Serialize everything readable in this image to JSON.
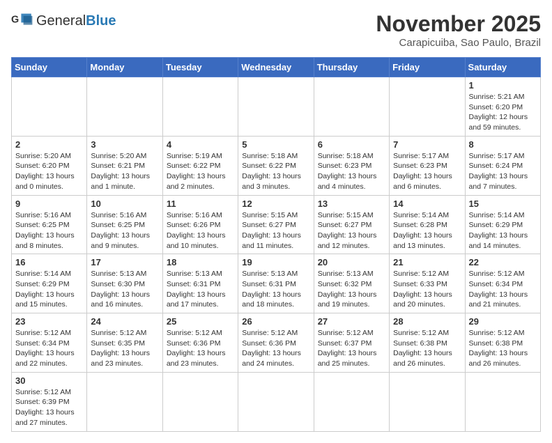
{
  "header": {
    "logo_general": "General",
    "logo_blue": "Blue",
    "month_title": "November 2025",
    "location": "Carapicuiba, Sao Paulo, Brazil"
  },
  "weekdays": [
    "Sunday",
    "Monday",
    "Tuesday",
    "Wednesday",
    "Thursday",
    "Friday",
    "Saturday"
  ],
  "weeks": [
    [
      {
        "day": "",
        "info": ""
      },
      {
        "day": "",
        "info": ""
      },
      {
        "day": "",
        "info": ""
      },
      {
        "day": "",
        "info": ""
      },
      {
        "day": "",
        "info": ""
      },
      {
        "day": "",
        "info": ""
      },
      {
        "day": "1",
        "info": "Sunrise: 5:21 AM\nSunset: 6:20 PM\nDaylight: 12 hours and 59 minutes."
      }
    ],
    [
      {
        "day": "2",
        "info": "Sunrise: 5:20 AM\nSunset: 6:20 PM\nDaylight: 13 hours and 0 minutes."
      },
      {
        "day": "3",
        "info": "Sunrise: 5:20 AM\nSunset: 6:21 PM\nDaylight: 13 hours and 1 minute."
      },
      {
        "day": "4",
        "info": "Sunrise: 5:19 AM\nSunset: 6:22 PM\nDaylight: 13 hours and 2 minutes."
      },
      {
        "day": "5",
        "info": "Sunrise: 5:18 AM\nSunset: 6:22 PM\nDaylight: 13 hours and 3 minutes."
      },
      {
        "day": "6",
        "info": "Sunrise: 5:18 AM\nSunset: 6:23 PM\nDaylight: 13 hours and 4 minutes."
      },
      {
        "day": "7",
        "info": "Sunrise: 5:17 AM\nSunset: 6:23 PM\nDaylight: 13 hours and 6 minutes."
      },
      {
        "day": "8",
        "info": "Sunrise: 5:17 AM\nSunset: 6:24 PM\nDaylight: 13 hours and 7 minutes."
      }
    ],
    [
      {
        "day": "9",
        "info": "Sunrise: 5:16 AM\nSunset: 6:25 PM\nDaylight: 13 hours and 8 minutes."
      },
      {
        "day": "10",
        "info": "Sunrise: 5:16 AM\nSunset: 6:25 PM\nDaylight: 13 hours and 9 minutes."
      },
      {
        "day": "11",
        "info": "Sunrise: 5:16 AM\nSunset: 6:26 PM\nDaylight: 13 hours and 10 minutes."
      },
      {
        "day": "12",
        "info": "Sunrise: 5:15 AM\nSunset: 6:27 PM\nDaylight: 13 hours and 11 minutes."
      },
      {
        "day": "13",
        "info": "Sunrise: 5:15 AM\nSunset: 6:27 PM\nDaylight: 13 hours and 12 minutes."
      },
      {
        "day": "14",
        "info": "Sunrise: 5:14 AM\nSunset: 6:28 PM\nDaylight: 13 hours and 13 minutes."
      },
      {
        "day": "15",
        "info": "Sunrise: 5:14 AM\nSunset: 6:29 PM\nDaylight: 13 hours and 14 minutes."
      }
    ],
    [
      {
        "day": "16",
        "info": "Sunrise: 5:14 AM\nSunset: 6:29 PM\nDaylight: 13 hours and 15 minutes."
      },
      {
        "day": "17",
        "info": "Sunrise: 5:13 AM\nSunset: 6:30 PM\nDaylight: 13 hours and 16 minutes."
      },
      {
        "day": "18",
        "info": "Sunrise: 5:13 AM\nSunset: 6:31 PM\nDaylight: 13 hours and 17 minutes."
      },
      {
        "day": "19",
        "info": "Sunrise: 5:13 AM\nSunset: 6:31 PM\nDaylight: 13 hours and 18 minutes."
      },
      {
        "day": "20",
        "info": "Sunrise: 5:13 AM\nSunset: 6:32 PM\nDaylight: 13 hours and 19 minutes."
      },
      {
        "day": "21",
        "info": "Sunrise: 5:12 AM\nSunset: 6:33 PM\nDaylight: 13 hours and 20 minutes."
      },
      {
        "day": "22",
        "info": "Sunrise: 5:12 AM\nSunset: 6:34 PM\nDaylight: 13 hours and 21 minutes."
      }
    ],
    [
      {
        "day": "23",
        "info": "Sunrise: 5:12 AM\nSunset: 6:34 PM\nDaylight: 13 hours and 22 minutes."
      },
      {
        "day": "24",
        "info": "Sunrise: 5:12 AM\nSunset: 6:35 PM\nDaylight: 13 hours and 23 minutes."
      },
      {
        "day": "25",
        "info": "Sunrise: 5:12 AM\nSunset: 6:36 PM\nDaylight: 13 hours and 23 minutes."
      },
      {
        "day": "26",
        "info": "Sunrise: 5:12 AM\nSunset: 6:36 PM\nDaylight: 13 hours and 24 minutes."
      },
      {
        "day": "27",
        "info": "Sunrise: 5:12 AM\nSunset: 6:37 PM\nDaylight: 13 hours and 25 minutes."
      },
      {
        "day": "28",
        "info": "Sunrise: 5:12 AM\nSunset: 6:38 PM\nDaylight: 13 hours and 26 minutes."
      },
      {
        "day": "29",
        "info": "Sunrise: 5:12 AM\nSunset: 6:38 PM\nDaylight: 13 hours and 26 minutes."
      }
    ],
    [
      {
        "day": "30",
        "info": "Sunrise: 5:12 AM\nSunset: 6:39 PM\nDaylight: 13 hours and 27 minutes."
      },
      {
        "day": "",
        "info": ""
      },
      {
        "day": "",
        "info": ""
      },
      {
        "day": "",
        "info": ""
      },
      {
        "day": "",
        "info": ""
      },
      {
        "day": "",
        "info": ""
      },
      {
        "day": "",
        "info": ""
      }
    ]
  ]
}
